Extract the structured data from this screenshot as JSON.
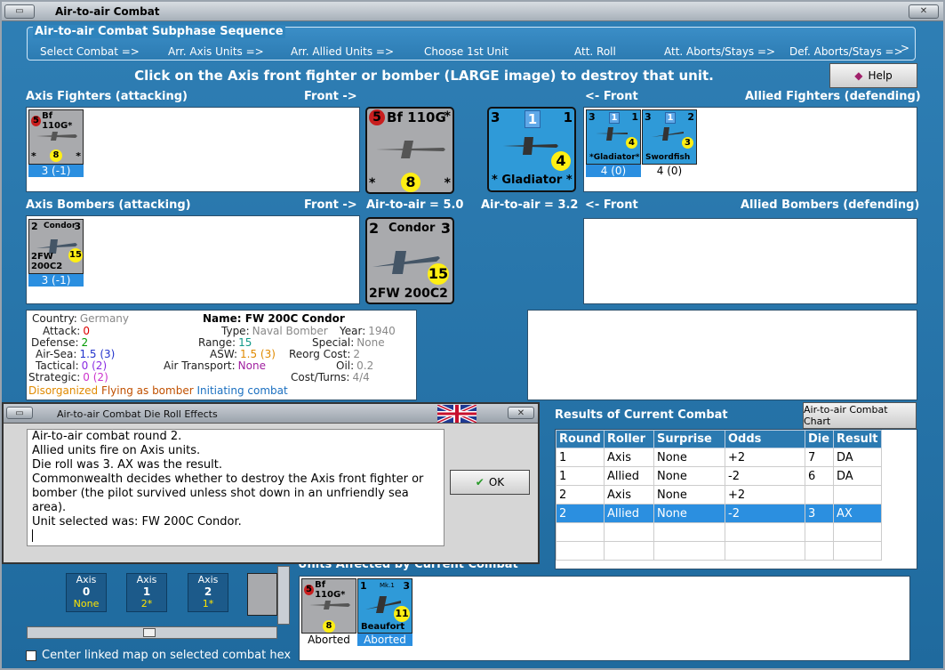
{
  "window": {
    "title": "Air-to-air Combat"
  },
  "subphase": {
    "legend": "Air-to-air Combat Subphase Sequence",
    "steps": [
      "Select Combat =>",
      "Arr. Axis Units =>",
      "Arr. Allied Units =>",
      "Choose 1st Unit",
      "Att. Roll",
      "Att. Aborts/Stays =>",
      "Def. Aborts/Stays =>"
    ]
  },
  "instruction": "Click on the Axis front fighter or bomber (LARGE image) to destroy that unit.",
  "help_label": "Help",
  "sections": {
    "axis_fighters": "Axis Fighters (attacking)",
    "axis_bombers": "Axis Bombers (attacking)",
    "allied_fighters": "Allied Fighters (defending)",
    "allied_bombers": "Allied Bombers (defending)",
    "front_right": "Front ->",
    "front_left": "<- Front"
  },
  "axis_fighters": [
    {
      "name": "Bf 110G*",
      "lvl": "5",
      "val": "8",
      "star_l": "*",
      "star_r": "*",
      "under": "3 (-1)"
    }
  ],
  "axis_bombers": [
    {
      "name": "Condor",
      "tl": "2",
      "tr": "3",
      "val": "15",
      "bottom": "2FW 200C2",
      "under": "3 (-1)"
    }
  ],
  "front_fighter": {
    "lvl": "5",
    "name": "Bf 110G",
    "star": "*",
    "val": "8",
    "rating": "Air-to-air = 5.0"
  },
  "front_bomber": {
    "tl": "2",
    "name": "Condor",
    "tr": "3",
    "val": "15",
    "bottom": "2FW 200C2"
  },
  "allied_front": {
    "tl": "3",
    "mid": "1",
    "tr": "1",
    "val": "4",
    "name": "* Gladiator *",
    "rating": "Air-to-air = 3.2"
  },
  "allied_fighters": [
    {
      "tl": "3",
      "mid": "1",
      "tr": "1",
      "val": "4",
      "name": "*Gladiator*",
      "under": "4 (0)"
    },
    {
      "tl": "3",
      "mid": "1",
      "tr": "2",
      "val": "3",
      "name": "Swordfish",
      "under": "4 (0)"
    }
  ],
  "info": {
    "country_l": "Country:",
    "country": "Germany",
    "attack_l": "Attack:",
    "attack": "0",
    "defense_l": "Defense:",
    "defense": "2",
    "airsea_l": "Air-Sea:",
    "airsea": "1.5 (3)",
    "tactical_l": "Tactical:",
    "tactical": "0 (2)",
    "strategic_l": "Strategic:",
    "strategic": "0 (2)",
    "name_l": "Name:",
    "name": "FW 200C Condor",
    "type_l": "Type:",
    "type": "Naval Bomber",
    "year_l": "Year:",
    "year": "1940",
    "range_l": "Range:",
    "range": "15",
    "special_l": "Special:",
    "special": "None",
    "asw_l": "ASW:",
    "asw": "1.5 (3)",
    "reorg_l": "Reorg Cost:",
    "reorg": "2",
    "airtrans_l": "Air Transport:",
    "airtrans": "None",
    "oil_l": "Oil:",
    "oil": "0.2",
    "costturns_l": "Cost/Turns:",
    "costturns": "4/4",
    "status1": "Disorganized",
    "status2": "Flying as bomber",
    "status3": "Initiating combat"
  },
  "dialog": {
    "title": "Air-to-air Combat Die Roll Effects",
    "lines": [
      "Air-to-air combat round 2.",
      "Allied units fire on Axis units.",
      "Die roll was 3.  AX was the result.",
      "Commonwealth decides whether to destroy the Axis front fighter or",
      "bomber (the pilot survived unless shot down in an unfriendly sea",
      "area).",
      "Unit selected was: FW 200C Condor."
    ],
    "ok": "OK"
  },
  "results": {
    "title": "Results of Current Combat",
    "chart_btn": "Air-to-air Combat Chart",
    "headers": [
      "Round",
      "Roller",
      "Surprise",
      "Odds",
      "Die",
      "Result"
    ],
    "rows": [
      [
        "1",
        "Axis",
        "None",
        "+2",
        "7",
        "DA"
      ],
      [
        "1",
        "Allied",
        "None",
        "-2",
        "6",
        "DA"
      ],
      [
        "2",
        "Axis",
        "None",
        "+2",
        "",
        ""
      ],
      [
        "2",
        "Allied",
        "None",
        "-2",
        "3",
        "AX"
      ]
    ]
  },
  "axis_boxes": [
    {
      "label": "Axis",
      "n": "0",
      "s": "None"
    },
    {
      "label": "Axis",
      "n": "1",
      "s": "2*"
    },
    {
      "label": "Axis",
      "n": "2",
      "s": "1*"
    }
  ],
  "affected": {
    "title": "Units Affected by Current Combat",
    "units": [
      {
        "name": "Bf 110G*",
        "lvl": "5",
        "val": "8",
        "under": "Aborted"
      },
      {
        "name": "Beaufort",
        "mk": "Mk.1",
        "tl": "1",
        "tr": "3",
        "val": "11",
        "under": "Aborted"
      }
    ]
  },
  "center_check": "Center linked map on selected combat hex"
}
